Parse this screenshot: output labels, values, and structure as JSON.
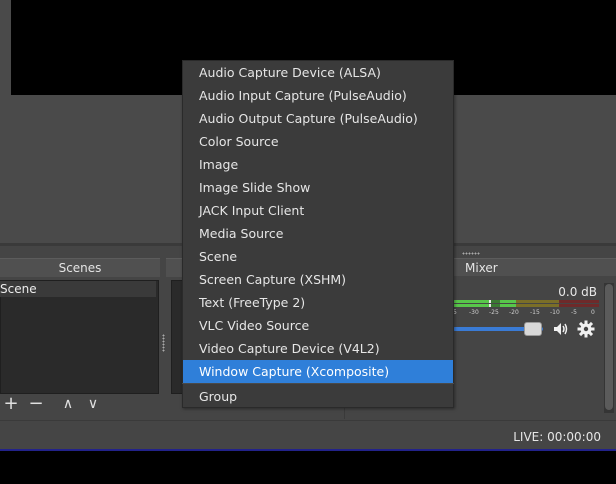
{
  "docks": {
    "scenes_title": "Scenes",
    "mixer_title": "Mixer"
  },
  "scenes": {
    "items": [
      "Scene"
    ],
    "toolbar": {
      "add": "+",
      "remove": "−",
      "up": "∧",
      "down": "∨"
    }
  },
  "mixer": {
    "level": "0.0 dB",
    "scale": [
      "5",
      "-30",
      "-25",
      "-20",
      "-15",
      "-10",
      "-5",
      "0"
    ],
    "volume": 0.88
  },
  "status": {
    "live": "LIVE: 00:00:00"
  },
  "context_menu": {
    "items": [
      "Audio Capture Device (ALSA)",
      "Audio Input Capture (PulseAudio)",
      "Audio Output Capture (PulseAudio)",
      "Color Source",
      "Image",
      "Image Slide Show",
      "JACK Input Client",
      "Media Source",
      "Scene",
      "Screen Capture (XSHM)",
      "Text (FreeType 2)",
      "VLC Video Source",
      "Video Capture Device (V4L2)",
      "Window Capture (Xcomposite)",
      "Group"
    ],
    "selected_index": 13
  },
  "colors": {
    "accent": "#2f7fd9",
    "meter_green": "#58c64a",
    "meter_yellow": "#c8b43a",
    "meter_red": "#b83a3a"
  },
  "icons": {
    "speaker": "speaker-icon",
    "gear": "gear-icon"
  }
}
